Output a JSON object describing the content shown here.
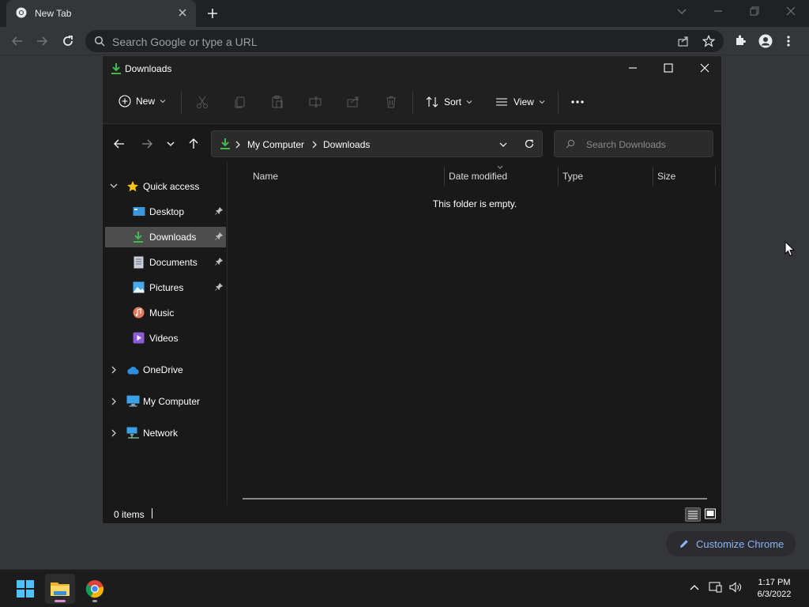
{
  "browser": {
    "tab_title": "New Tab",
    "omnibox_placeholder": "Search Google or type a URL",
    "customize_label": "Customize Chrome"
  },
  "explorer": {
    "window_title": "Downloads",
    "commands": {
      "new_label": "New",
      "sort_label": "Sort",
      "view_label": "View"
    },
    "address": {
      "segments": [
        "My Computer",
        "Downloads"
      ]
    },
    "search_placeholder": "Search Downloads",
    "sidebar": {
      "quick_access": "Quick access",
      "items": [
        {
          "label": "Desktop",
          "icon": "desktop-icon",
          "pinned": true
        },
        {
          "label": "Downloads",
          "icon": "download-icon",
          "pinned": true,
          "selected": true
        },
        {
          "label": "Documents",
          "icon": "documents-icon",
          "pinned": true
        },
        {
          "label": "Pictures",
          "icon": "pictures-icon",
          "pinned": true
        },
        {
          "label": "Music",
          "icon": "music-icon",
          "pinned": false
        },
        {
          "label": "Videos",
          "icon": "videos-icon",
          "pinned": false
        }
      ],
      "roots": [
        {
          "label": "OneDrive",
          "icon": "onedrive-icon"
        },
        {
          "label": "My Computer",
          "icon": "computer-icon"
        },
        {
          "label": "Network",
          "icon": "network-icon"
        }
      ]
    },
    "columns": [
      "Name",
      "Date modified",
      "Type",
      "Size"
    ],
    "empty_message": "This folder is empty.",
    "status": "0 items"
  },
  "taskbar": {
    "time": "1:17 PM",
    "date": "6/3/2022"
  },
  "colors": {
    "accent_blue": "#8ab4f8",
    "download_green": "#3fb950",
    "selected_bg": "#4d4d4d"
  }
}
